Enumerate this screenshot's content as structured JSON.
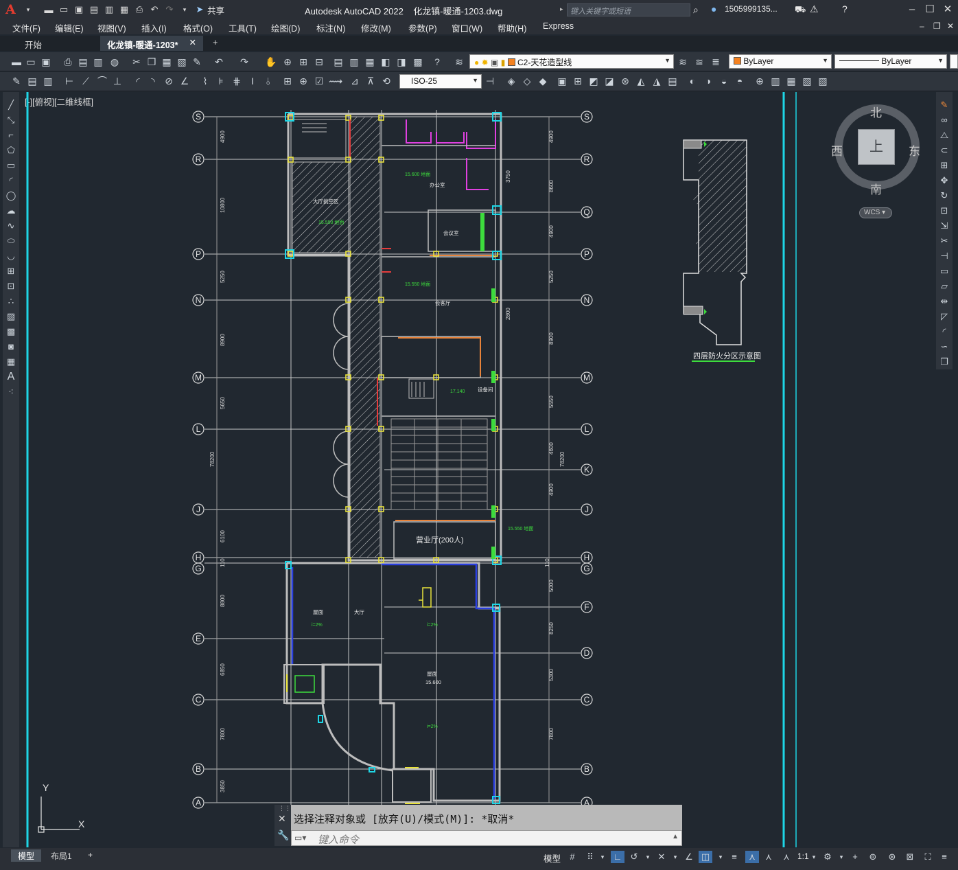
{
  "window": {
    "app_name": "Autodesk AutoCAD 2022",
    "filename": "化龙镇-暖通-1203.dwg",
    "search_placeholder": "键入关键字或短语",
    "user": "1505999135...",
    "share_label": "共享"
  },
  "menu": [
    "文件(F)",
    "编辑(E)",
    "视图(V)",
    "插入(I)",
    "格式(O)",
    "工具(T)",
    "绘图(D)",
    "标注(N)",
    "修改(M)",
    "参数(P)",
    "窗口(W)",
    "帮助(H)",
    "Express"
  ],
  "tabs": [
    {
      "label": "开始",
      "active": false
    },
    {
      "label": "化龙镇-暖通-1203*",
      "active": true
    }
  ],
  "toolbar": {
    "layer_name": "C2-天花造型线",
    "color": "ByLayer",
    "linetype": "ByLayer",
    "dimstyle": "ISO-25"
  },
  "viewport_label": "[-][俯视][二维线框]",
  "viewcube": {
    "north": "北",
    "south": "南",
    "east": "东",
    "west": "西",
    "face": "上",
    "ucs": "WCS"
  },
  "drawing": {
    "grid_rows": [
      {
        "label": "S",
        "right": "S"
      },
      {
        "label": "R",
        "right": "R"
      },
      {
        "label": "",
        "right": "Q"
      },
      {
        "label": "P",
        "right": "P"
      },
      {
        "label": "N",
        "right": "N"
      },
      {
        "label": "M",
        "right": "M"
      },
      {
        "label": "L",
        "right": "L"
      },
      {
        "label": "",
        "right": "K"
      },
      {
        "label": "J",
        "right": "J"
      },
      {
        "label": "H",
        "right": "H"
      },
      {
        "label": "G",
        "right": "G"
      },
      {
        "label": "",
        "right": "F"
      },
      {
        "label": "E",
        "right": ""
      },
      {
        "label": "",
        "right": "D"
      },
      {
        "label": "C",
        "right": "C"
      },
      {
        "label": "B",
        "right": "B"
      },
      {
        "label": "A",
        "right": "A"
      }
    ],
    "left_dims": [
      "4900",
      "10800",
      "5250",
      "8900",
      "5650",
      "78200",
      "6100",
      "110",
      "8800",
      "6850",
      "7800",
      "3850"
    ],
    "right_dims": [
      "4900",
      "8600",
      "3750",
      "4900",
      "5250",
      "2800",
      "8900",
      "5550",
      "4600",
      "78200",
      "4900",
      "110",
      "5000",
      "8250",
      "5300",
      "7800"
    ],
    "room_labels": [
      "大厅挑空区",
      "会议室",
      "办公室",
      "会客厅",
      "营业厅(200人)",
      "屋面",
      "大厅",
      "设备间",
      "15.600 地面",
      "15.550 地面",
      "17.140",
      "i=2%",
      "15.600"
    ],
    "keyplan_title": "四层防火分区示意图"
  },
  "command": {
    "history": "选择注释对象或 [放弃(U)/模式(M)]: *取消*",
    "placeholder": "键入命令"
  },
  "status": {
    "tabs": [
      {
        "label": "模型",
        "active": true
      },
      {
        "label": "布局1",
        "active": false
      }
    ],
    "model_label": "模型",
    "scale": "1:1"
  },
  "ucs_icon": {
    "x_label": "X",
    "y_label": "Y"
  },
  "colors": {
    "accent_cyan": "#1ed6e6",
    "grid_line": "#c8c8c8",
    "wall_yellow": "#e8e23a",
    "highlight_magenta": "#e040e0",
    "green_text": "#3ddc3d",
    "blue_wall": "#2a3fe0"
  }
}
